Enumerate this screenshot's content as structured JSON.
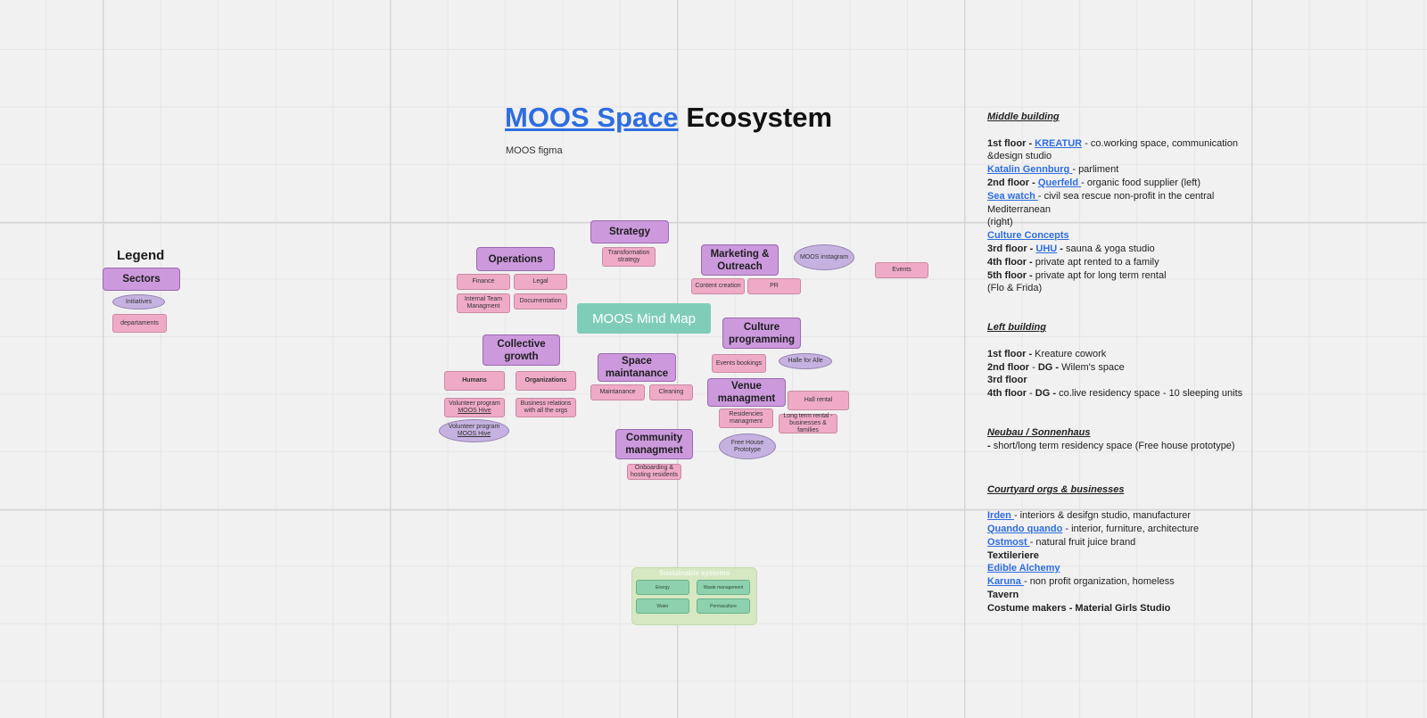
{
  "title": {
    "link_part": "MOOS Space",
    "rest": "Ecosystem",
    "subtitle": "MOOS figma"
  },
  "legend": {
    "heading": "Legend",
    "sector": "Sectors",
    "initiative": "Initiatives",
    "department": "departaments"
  },
  "center": "MOOS Mind Map",
  "sectors": {
    "strategy": "Strategy",
    "operations": "Operations",
    "marketing": "Marketing & Outreach",
    "collective": "Collective growth",
    "culture": "Culture programming",
    "space": "Space maintanance",
    "venue": "Venue managment",
    "community": "Community managment"
  },
  "depts": {
    "transformation": "Transformation strategy",
    "finance": "Finance",
    "legal": "Legal",
    "internal": "Internal Team Managment",
    "documentation": "Documentation",
    "content": "Content creation",
    "pr": "PR",
    "events": "Events",
    "events_bookings": "Events bookings",
    "humans": "Humans",
    "organizations": "Organizations",
    "volunteer_1": "Volunteer program",
    "volunteer_1_link": "MOOS Hive",
    "business": "Business relations with all the orgs",
    "maintanance": "Maintanance",
    "cleaning": "Cleaning",
    "hall": "Hall rental",
    "residencies": "Residencies managment",
    "longterm": "Long term rental - businesses & families",
    "onboarding": "Onboarding & hosting residents"
  },
  "initiatives": {
    "instagram": "MOOS instagram",
    "halle": "Halle for Alle",
    "volunteer_2": "Volunteer program",
    "volunteer_2_link": "MOOS Hive",
    "freehouse": "Free House Prototype"
  },
  "sustainable": {
    "title": "Sustainable systems",
    "energy": "Energy",
    "waste": "Waste management",
    "water": "Water",
    "permaculture": "Permaculture"
  },
  "notes": {
    "middle": {
      "heading": "Middle building",
      "f1_label": "1st floor - ",
      "f1_link": "KREATUR",
      "f1_rest": " - co.working space, communication &design studio",
      "katalin_link": "Katalin Gennburg ",
      "katalin_rest": "- parliment",
      "f2_label": "2nd floor - ",
      "f2_link": "Querfeld ",
      "f2_rest": "- organic food supplier  (left)",
      "sea_link": "Sea watch ",
      "sea_rest": "- civil sea rescue non-profit in the central Mediterranean",
      "sea_rest2": "(right)",
      "culture_link": "Culture Concepts",
      "f3_label": "3rd floor - ",
      "f3_link": "UHU",
      "f3_bold": " - ",
      "f3_rest": "sauna & yoga studio",
      "f4_label": "4th floor - ",
      "f4_rest": "private apt rented to a family",
      "f5_label": "5th floor - ",
      "f5_rest": "private apt for long term rental",
      "f5_rest2": "(Flo & Frida)"
    },
    "left": {
      "heading": "Left building",
      "f1_label": "1st floor - ",
      "f1_rest": "Kreature cowork",
      "f2_label": "2nd floor",
      "f2_mid": " - ",
      "f2_dg": "DG -",
      "f2_rest": " Wilem's space",
      "f3_label": "3rd floor",
      "f4_label": "4th floor",
      "f4_mid": " - ",
      "f4_dg": "DG -",
      "f4_rest": " co.live residency space - 10 sleeping units"
    },
    "neubau": {
      "heading": "Neubau / Sonnenhaus",
      "bold": "- ",
      "rest": "short/long term residency space (Free house prototype)"
    },
    "courtyard": {
      "heading": "Courtyard orgs & businesses",
      "irden_link": "Irden ",
      "irden_rest": "- interiors & desifgn studio, manufacturer",
      "quando_link": "Quando quando",
      "quando_rest": " - interior, furniture, architecture",
      "ostmost_link": "Ostmost ",
      "ostmost_rest": "- natural fruit juice brand",
      "textiliere": "Textileriere",
      "edible_link": "Edible Alchemy ",
      "karuna_link": "Karuna ",
      "karuna_rest": "- non profit organization, homeless",
      "tavern": "Tavern",
      "costume": "Costume makers - Material Girls Studio"
    }
  },
  "colors": {
    "link": "#2e6de0",
    "sector": "#cc99dd",
    "department": "#efabc6",
    "initiative": "#c6b2e0",
    "center": "#7fcdb8",
    "sustainable": "#d5e8c2"
  }
}
